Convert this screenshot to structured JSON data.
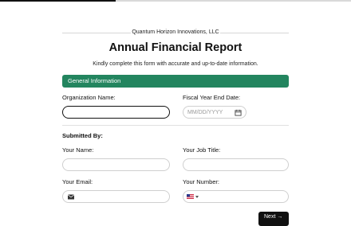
{
  "progress": {
    "fraction": 0.33
  },
  "header": {
    "company": "Quantum Horizon Innovations, LLC",
    "title": "Annual Financial Report",
    "subtitle": "Kindly complete this form with accurate and up-to-date information."
  },
  "section": {
    "title": "General Information"
  },
  "fields": {
    "organization_name": {
      "label": "Organization Name:",
      "value": ""
    },
    "fiscal_year_end": {
      "label": "Fiscal Year End Date:",
      "placeholder": "MM/DD/YYYY"
    },
    "submitted_by": "Submitted By:",
    "your_name": {
      "label": "Your Name:",
      "value": ""
    },
    "job_title": {
      "label": "Your Job Title:",
      "value": ""
    },
    "email": {
      "label": "Your Email:",
      "value": ""
    },
    "number": {
      "label": "Your Number:",
      "value": ""
    }
  },
  "icons": {
    "calendar": "calendar-icon",
    "email": "mail-icon",
    "flag": "us-flag-icon",
    "dropdown": "chevron-down-icon",
    "next": "arrow-right-icon"
  },
  "colors": {
    "accent": "#23855f",
    "button": "#111111"
  },
  "buttons": {
    "next": "Next",
    "next_arrow": "→"
  }
}
